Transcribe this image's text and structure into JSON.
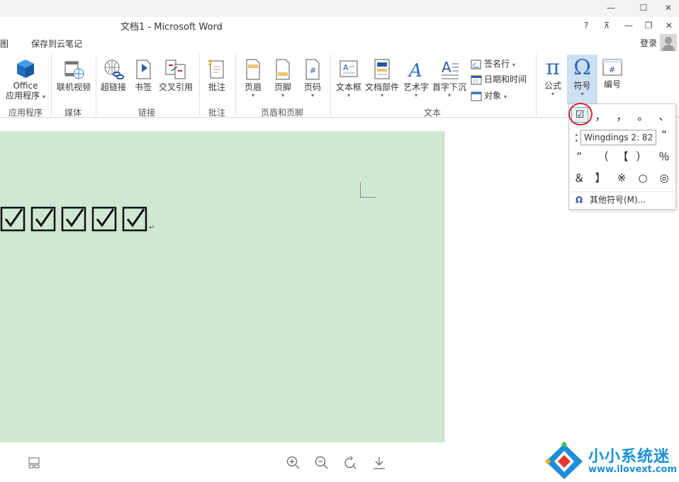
{
  "window": {
    "title": "文档1 - Microsoft Word",
    "controls": [
      "?",
      "restore-ribbon",
      "minimize",
      "maximize",
      "close"
    ]
  },
  "tabs": [
    "图",
    "保存到云笔记"
  ],
  "account": {
    "login": "登录"
  },
  "ribbon": {
    "groups": {
      "apps": {
        "label": "应用程序",
        "office_line1": "Office",
        "office_line2": "应用程序"
      },
      "media": {
        "label": "媒体",
        "online_video": "联机视频"
      },
      "links": {
        "label": "链接",
        "hyperlink": "超链接",
        "bookmark": "书签",
        "cross_ref": "交叉引用"
      },
      "comments": {
        "label": "批注",
        "comment": "批注"
      },
      "header_footer": {
        "label": "页眉和页脚",
        "header": "页眉",
        "footer": "页脚",
        "page_number": "页码"
      },
      "text": {
        "label": "文本",
        "textbox": "文本框",
        "quick_parts": "文档部件",
        "wordart": "艺术字",
        "dropcap": "首字下沉",
        "signature": "签名行",
        "datetime": "日期和时间",
        "object": "对象"
      },
      "symbols": {
        "equation": "公式",
        "symbol": "符号",
        "number": "编号"
      }
    }
  },
  "document": {
    "checkboxes": [
      "☑",
      "☑",
      "☑",
      "☑",
      "☑"
    ],
    "paragraph_mark": "↵",
    "page_color": "#cfe8d2"
  },
  "symbol_dropdown": {
    "selected": "☑",
    "tooltip": "Wingdings 2: 82",
    "rows": [
      [
        "☑",
        "，",
        "，",
        "。",
        "、"
      ],
      [
        "：",
        "",
        "",
        "",
        "“"
      ],
      [
        "”",
        "（",
        "【",
        "）",
        "％"
      ],
      [
        "＆",
        "】",
        "※",
        "○",
        "◎"
      ]
    ],
    "more_symbols": "其他符号(M)..."
  },
  "watermark": {
    "name": "小小系统迷",
    "url": "www.ilovext.com"
  },
  "colors": {
    "accent": "#2b5aa8",
    "highlight": "#cde0f2",
    "annotation_red": "#d0262c",
    "watermark_blue": "#1b8fd8"
  }
}
